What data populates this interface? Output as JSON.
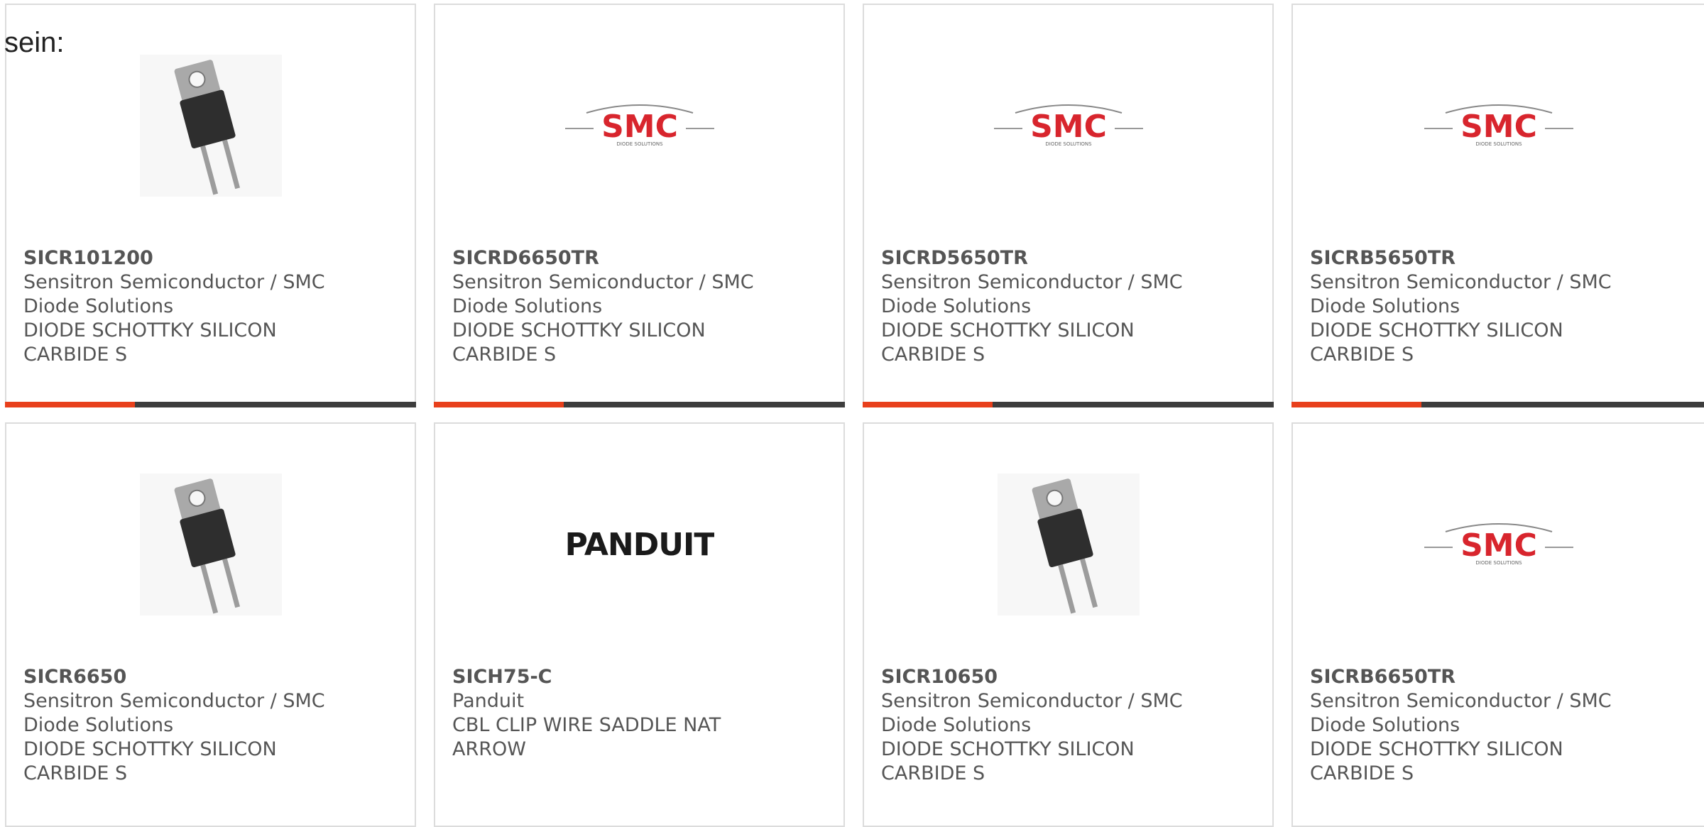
{
  "prefix_text": "sein:",
  "colors": {
    "accent": "#e8401c",
    "bar": "#3d3d3d",
    "border": "#dcdcdc",
    "smc_red": "#d8252d"
  },
  "products": [
    {
      "part": "SICR101200",
      "manufacturer": "Sensitron Semiconductor / SMC Diode Solutions",
      "manufacturer_line1": "Sensitron Semiconductor / SMC",
      "manufacturer_line2": "Diode Solutions",
      "description_line1": "DIODE SCHOTTKY SILICON",
      "description_line2": "CARBIDE S",
      "image": "to220-diode-image"
    },
    {
      "part": "SICRD6650TR",
      "manufacturer_line1": "Sensitron Semiconductor / SMC",
      "manufacturer_line2": "Diode Solutions",
      "description_line1": "DIODE SCHOTTKY SILICON",
      "description_line2": "CARBIDE S",
      "image": "smc-logo",
      "logo_text": "SMC",
      "logo_subtext": "DIODE SOLUTIONS"
    },
    {
      "part": "SICRD5650TR",
      "manufacturer_line1": "Sensitron Semiconductor / SMC",
      "manufacturer_line2": "Diode Solutions",
      "description_line1": "DIODE SCHOTTKY SILICON",
      "description_line2": "CARBIDE S",
      "image": "smc-logo",
      "logo_text": "SMC",
      "logo_subtext": "DIODE SOLUTIONS"
    },
    {
      "part": "SICRB5650TR",
      "manufacturer_line1": "Sensitron Semiconductor / SMC",
      "manufacturer_line2": "Diode Solutions",
      "description_line1": "DIODE SCHOTTKY SILICON",
      "description_line2": "CARBIDE S",
      "image": "smc-logo",
      "logo_text": "SMC",
      "logo_subtext": "DIODE SOLUTIONS"
    },
    {
      "part": "SICR6650",
      "manufacturer_line1": "Sensitron Semiconductor / SMC",
      "manufacturer_line2": "Diode Solutions",
      "description_line1": "DIODE SCHOTTKY SILICON",
      "description_line2": "CARBIDE S",
      "image": "to220-diode-image"
    },
    {
      "part": "SICH75-C",
      "manufacturer_line1": "Panduit",
      "manufacturer_line2": "",
      "description_line1": "CBL CLIP WIRE SADDLE NAT",
      "description_line2": "ARROW",
      "image": "panduit-logo",
      "logo_text": "PANDUIT"
    },
    {
      "part": "SICR10650",
      "manufacturer_line1": "Sensitron Semiconductor / SMC",
      "manufacturer_line2": "Diode Solutions",
      "description_line1": "DIODE SCHOTTKY SILICON",
      "description_line2": "CARBIDE S",
      "image": "to220-diode-image"
    },
    {
      "part": "SICRB6650TR",
      "manufacturer_line1": "Sensitron Semiconductor / SMC",
      "manufacturer_line2": "Diode Solutions",
      "description_line1": "DIODE SCHOTTKY SILICON",
      "description_line2": "CARBIDE S",
      "image": "smc-logo",
      "logo_text": "SMC",
      "logo_subtext": "DIODE SOLUTIONS"
    }
  ]
}
